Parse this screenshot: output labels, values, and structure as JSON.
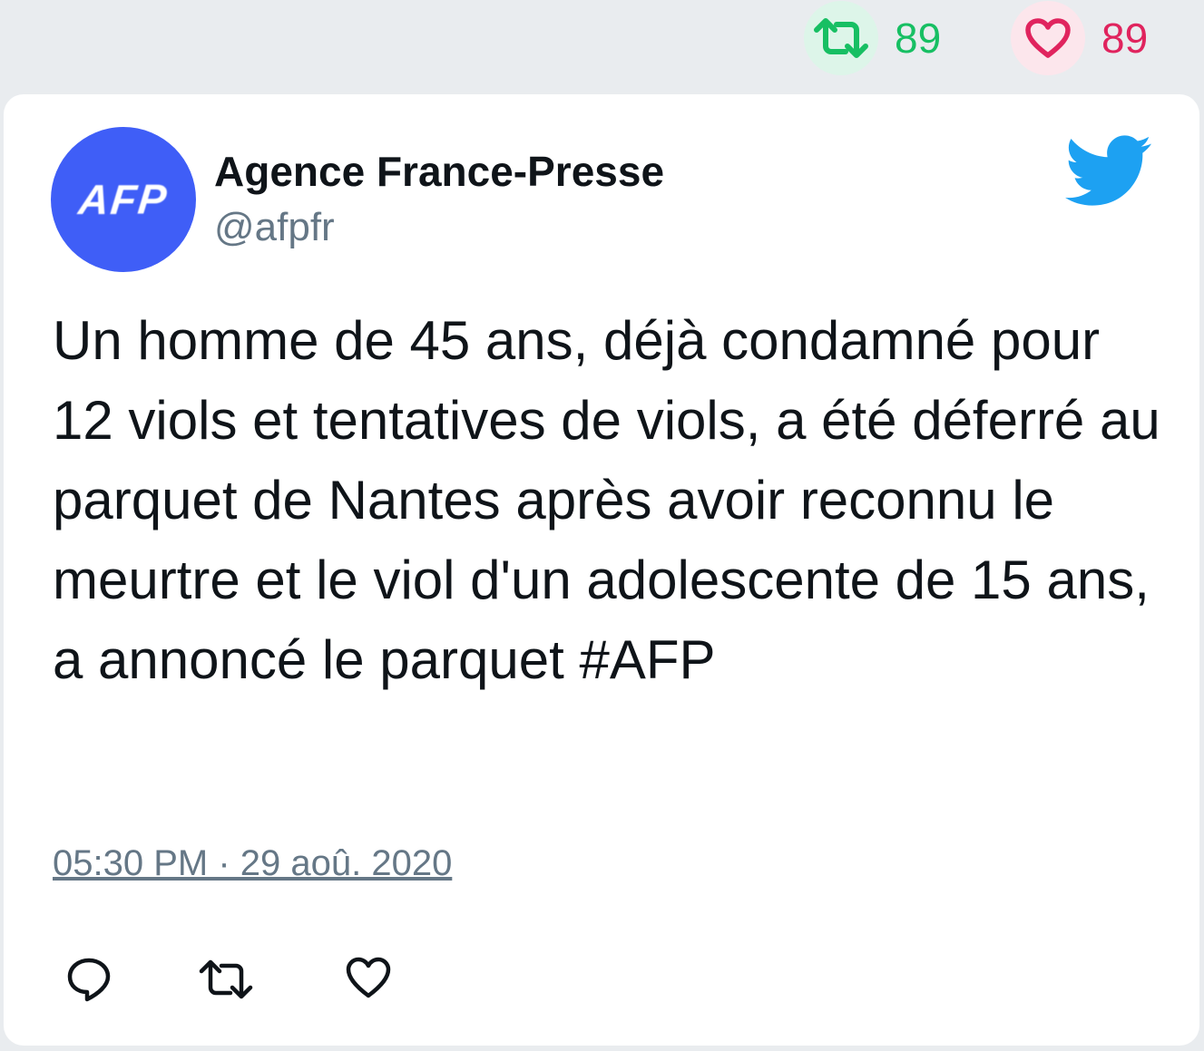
{
  "stats": {
    "retweets": "89",
    "likes": "89"
  },
  "tweet": {
    "avatar_text": "AFP",
    "author_name": "Agence France-Presse",
    "author_handle": "@afpfr",
    "text": "Un homme de 45 ans, déjà condamné pour 12 viols et tentatives de viols, a été déferré au parquet de Nantes après avoir reconnu le meurtre et le viol d'un adolescente de 15 ans, a annoncé le parquet #AFP",
    "timestamp": "05:30 PM · 29 aoû. 2020"
  },
  "icons": {
    "retweet": "retweet-icon",
    "like": "heart-icon",
    "reply": "reply-icon",
    "brand": "twitter-bird-icon"
  },
  "colors": {
    "retweet": "#17bf63",
    "retweet_bg": "#ddf5e9",
    "like": "#e0245e",
    "like_bg": "#fce6ec",
    "brand": "#1da1f2",
    "avatar_bg": "#3f5ef7",
    "muted": "#657786"
  }
}
